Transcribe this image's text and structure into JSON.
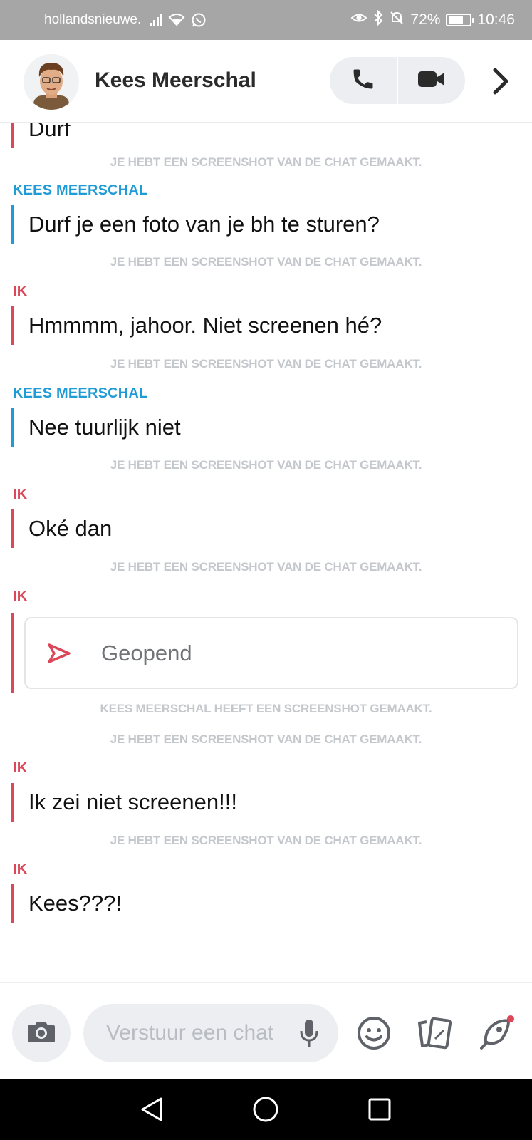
{
  "status_bar": {
    "carrier": "hollandsnieuwe.",
    "battery": "72%",
    "battery_level": 0.72,
    "time": "10:46"
  },
  "header": {
    "contact_name": "Kees Meerschal"
  },
  "messages": [
    {
      "kind": "text",
      "sender": "",
      "text": "Durf",
      "color": "red"
    },
    {
      "kind": "system",
      "text": "JE HEBT EEN SCREENSHOT VAN DE CHAT GEMAAKT."
    },
    {
      "kind": "text",
      "sender": "KEES MEERSCHAL",
      "text": "Durf je een foto van je bh te sturen?",
      "color": "blue"
    },
    {
      "kind": "system",
      "text": "JE HEBT EEN SCREENSHOT VAN DE CHAT GEMAAKT."
    },
    {
      "kind": "text",
      "sender": "IK",
      "text": "Hmmmm, jahoor. Niet screenen hé?",
      "color": "red"
    },
    {
      "kind": "system",
      "text": "JE HEBT EEN SCREENSHOT VAN DE CHAT GEMAAKT."
    },
    {
      "kind": "text",
      "sender": "KEES MEERSCHAL",
      "text": "Nee tuurlijk niet",
      "color": "blue"
    },
    {
      "kind": "system",
      "text": "JE HEBT EEN SCREENSHOT VAN DE CHAT GEMAAKT."
    },
    {
      "kind": "text",
      "sender": "IK",
      "text": "Oké dan",
      "color": "red"
    },
    {
      "kind": "system",
      "text": "JE HEBT EEN SCREENSHOT VAN DE CHAT GEMAAKT."
    },
    {
      "kind": "snap",
      "sender": "IK",
      "text": "Geopend",
      "color": "red"
    },
    {
      "kind": "system",
      "text": "KEES MEERSCHAL HEEFT EEN SCREENSHOT GEMAAKT."
    },
    {
      "kind": "system",
      "text": "JE HEBT EEN SCREENSHOT VAN DE CHAT GEMAAKT."
    },
    {
      "kind": "text",
      "sender": "IK",
      "text": "Ik zei niet screenen!!!",
      "color": "red"
    },
    {
      "kind": "system",
      "text": "JE HEBT EEN SCREENSHOT VAN DE CHAT GEMAAKT."
    },
    {
      "kind": "text",
      "sender": "IK",
      "text": "Kees???!",
      "color": "red"
    }
  ],
  "composer": {
    "placeholder": "Verstuur een chat"
  },
  "colors": {
    "blue": "#1f9bd6",
    "red": "#dc4759",
    "system_gray": "#c4c7cc",
    "status_bar": "#a6a6a6"
  },
  "icons": {
    "call": "phone-icon",
    "video": "video-camera-icon",
    "more": "chevron-right-icon",
    "camera": "camera-icon",
    "mic": "microphone-icon",
    "emoji": "smiley-icon",
    "stickers": "cards-icon",
    "games": "rocket-icon"
  }
}
